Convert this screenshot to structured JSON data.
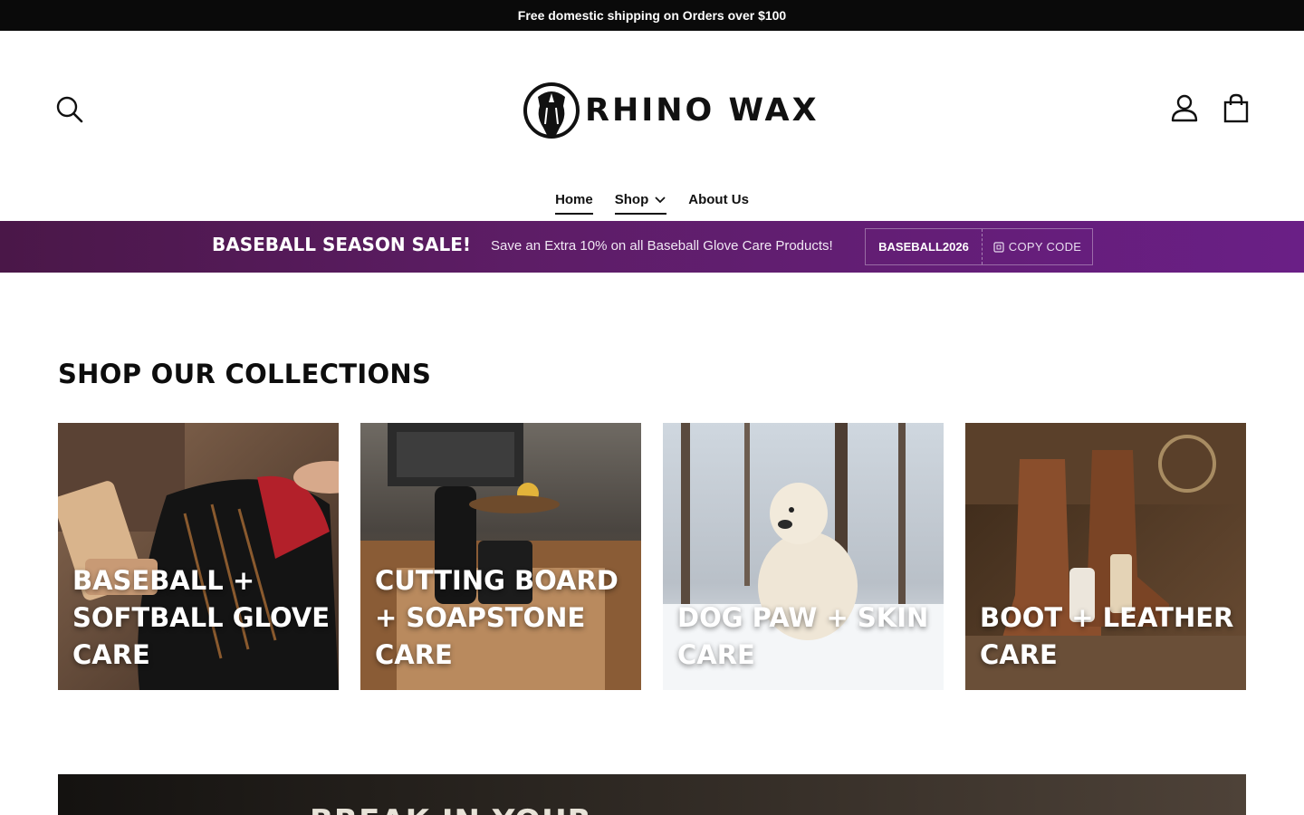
{
  "announcement": {
    "text": "Free domestic shipping on Orders over $100"
  },
  "header": {
    "logo_text": "RHINO WAX",
    "search_icon": "search-icon",
    "account_icon": "user-icon",
    "cart_icon": "shopping-bag-icon"
  },
  "nav": {
    "items": [
      {
        "label": "Home",
        "active": true
      },
      {
        "label": "Shop",
        "has_dropdown": true
      },
      {
        "label": "About Us"
      }
    ]
  },
  "promo": {
    "title": "BASEBALL SEASON SALE!",
    "subtitle": "Save an Extra 10% on all Baseball Glove Care Products!",
    "code": "BASEBALL2026",
    "copy_label": "COPY CODE"
  },
  "collections": {
    "title": "SHOP OUR COLLECTIONS",
    "cards": [
      {
        "label": "Baseball + Softball Glove Care"
      },
      {
        "label": "Cutting Board + Soapstone Care"
      },
      {
        "label": "Dog Paw + Skin Care"
      },
      {
        "label": "Boot + Leather Care"
      }
    ]
  },
  "hero": {
    "text": "BREAK IN YOUR"
  },
  "colors": {
    "announcement_bg": "#0a0a0a",
    "promo_bg": "#5d1d66",
    "text": "#111111"
  }
}
